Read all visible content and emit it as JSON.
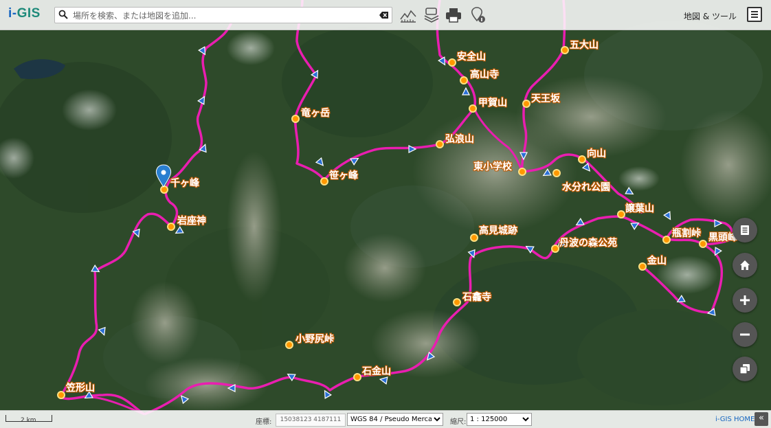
{
  "app": {
    "logo_prefix": "i-",
    "logo_suffix": "GIS",
    "accent_color": "#1e8a7a"
  },
  "search": {
    "placeholder": "場所を検索、または地図を追加..."
  },
  "toolbar": {
    "icons": [
      "elevation-profile-icon",
      "layers-stack-icon",
      "print-icon",
      "location-info-icon"
    ]
  },
  "menu": {
    "label": "地図 & ツール"
  },
  "map": {
    "route_color": "#e91eb0",
    "places": [
      {
        "name": "五大山"
      },
      {
        "name": "安全山"
      },
      {
        "name": "高山寺"
      },
      {
        "name": "甲賀山"
      },
      {
        "name": "天王坂"
      },
      {
        "name": "竜ヶ岳"
      },
      {
        "name": "弘浪山"
      },
      {
        "name": "笹ヶ峰"
      },
      {
        "name": "向山"
      },
      {
        "name": "東小学校"
      },
      {
        "name": "水分れ公園"
      },
      {
        "name": "千ヶ峰"
      },
      {
        "name": "譲葉山"
      },
      {
        "name": "岩座神"
      },
      {
        "name": "瓶割峠"
      },
      {
        "name": "黒頭峰"
      },
      {
        "name": "高見城跡"
      },
      {
        "name": "丹波の森公苑"
      },
      {
        "name": "金山"
      },
      {
        "name": "石龕寺"
      },
      {
        "name": "小野尻峠"
      },
      {
        "name": "石金山"
      },
      {
        "name": "笠形山"
      }
    ]
  },
  "controls": {
    "list_icon": "list-icon",
    "home_icon": "home-icon",
    "zoom_in_icon": "plus-icon",
    "zoom_out_icon": "minus-icon",
    "basemap_icon": "layers-icon"
  },
  "status": {
    "scale_bar_text": "2 km",
    "coord_label": "座標:",
    "coordinates": "15038123 4187111",
    "crs_selected": "WGS 84 / Pseudo Mercator",
    "scale_label": "縮尺:",
    "scale_selected": "1 : 125000",
    "home_link": "i-GIS HOME",
    "collapse_symbol": "«"
  }
}
